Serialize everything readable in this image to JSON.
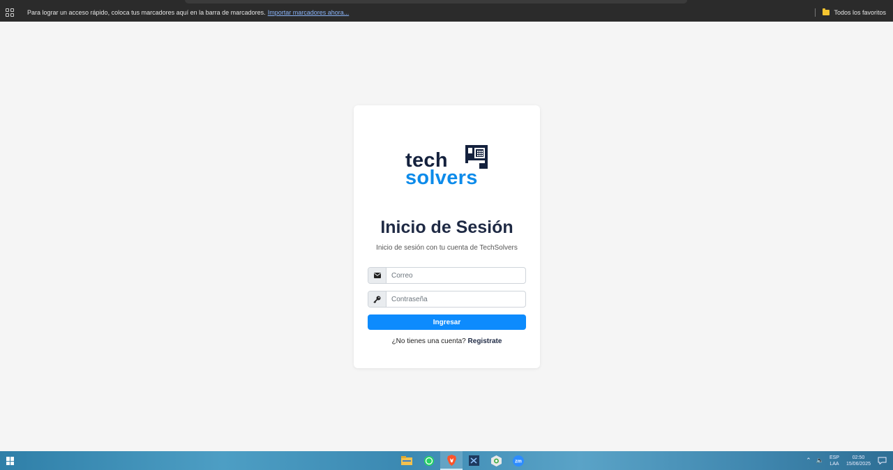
{
  "browser": {
    "bookmarks_bar": {
      "message": "Para lograr un acceso rápido, coloca tus marcadores aquí en la barra de marcadores.",
      "import_link": "Importar marcadores ahora...",
      "all_favorites": "Todos los favoritos"
    }
  },
  "login": {
    "logo": {
      "word1": "tech",
      "word2": "solvers"
    },
    "title": "Inicio de Sesión",
    "subtitle": "Inicio de sesión con tu cuenta de TechSolvers",
    "email": {
      "placeholder": "Correo",
      "value": ""
    },
    "password": {
      "placeholder": "Contraseña",
      "value": ""
    },
    "submit_label": "Ingresar",
    "signup_prompt": "¿No tienes una cuenta?",
    "signup_link": "Registrate"
  },
  "taskbar": {
    "apps": [
      "file-explorer-icon",
      "whatsapp-icon",
      "brave-icon",
      "vscode-icon",
      "chrome-dev-icon",
      "zoom-icon"
    ],
    "active_app": "brave-icon",
    "zoom_label": "zm",
    "lang_top": "ESP",
    "lang_bottom": "LAA",
    "time": "02:50",
    "date": "15/06/2025"
  },
  "colors": {
    "brand_dark": "#14213d",
    "brand_blue": "#0d8bea",
    "primary_button": "#0d8bfd",
    "page_bg": "#f5f5f5"
  }
}
